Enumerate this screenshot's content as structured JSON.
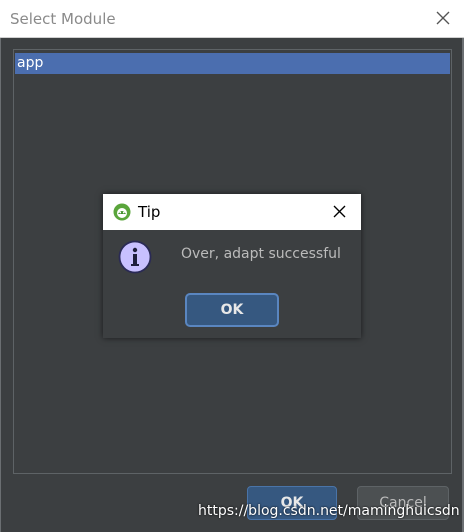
{
  "outer_dialog": {
    "title": "Select Module",
    "modules": [
      {
        "label": "app",
        "selected": true
      }
    ],
    "ok_label": "OK",
    "cancel_label": "Cancel"
  },
  "tip_dialog": {
    "title": "Tip",
    "message": "Over, adapt successful",
    "ok_label": "OK"
  },
  "watermark": "https://blog.csdn.net/maminghuicsdn",
  "colors": {
    "background": "#3c3f41",
    "selection": "#4b6eaf",
    "default_button": "#365880",
    "info_icon": "#c8c0ff"
  }
}
